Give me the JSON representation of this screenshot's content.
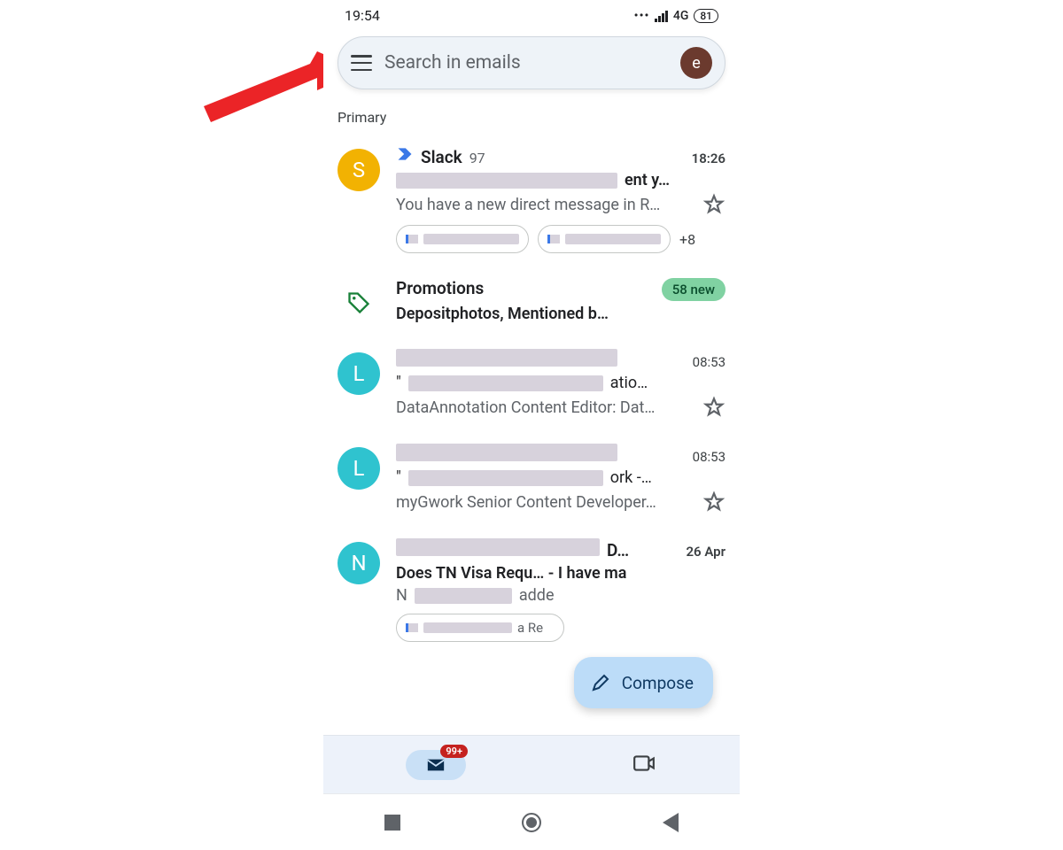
{
  "statusbar": {
    "time": "19:54",
    "network": "4G",
    "battery": "81"
  },
  "search": {
    "placeholder": "Search in emails",
    "avatar_initial": "e"
  },
  "section_label": "Primary",
  "promotions": {
    "title": "Promotions",
    "subtitle": "Depositphotos, Mentioned b…",
    "badge": "58 new"
  },
  "compose_label": "Compose",
  "mail_badge": "99+",
  "emails": [
    {
      "avatar_letter": "S",
      "avatar_class": "av-s",
      "sender": "Slack",
      "count": "97",
      "time": "18:26",
      "bold": true,
      "subject_suffix": "ent y…",
      "snippet": "You have a new direct message in R…",
      "chips_more": "+8"
    },
    {
      "avatar_letter": "L",
      "avatar_class": "av-l",
      "sender_redacted": true,
      "time": "08:53",
      "bold": false,
      "subject_suffix": "atio…",
      "snippet": "DataAnnotation Content Editor: Dat…"
    },
    {
      "avatar_letter": "L",
      "avatar_class": "av-l",
      "sender_redacted": true,
      "time": "08:53",
      "bold": false,
      "subject_suffix": "ork -…",
      "snippet": "myGwork Senior Content Developer…"
    },
    {
      "avatar_letter": "N",
      "avatar_class": "av-n",
      "sender_redacted": true,
      "sender_suffix": " D…",
      "time": "26 Apr",
      "bold": true,
      "subject_prefix": "Does TN Visa Requ… - I have ma",
      "snippet_prefix": "N",
      "snippet_suffix": "adde",
      "chip_suffix": "a Re"
    }
  ]
}
